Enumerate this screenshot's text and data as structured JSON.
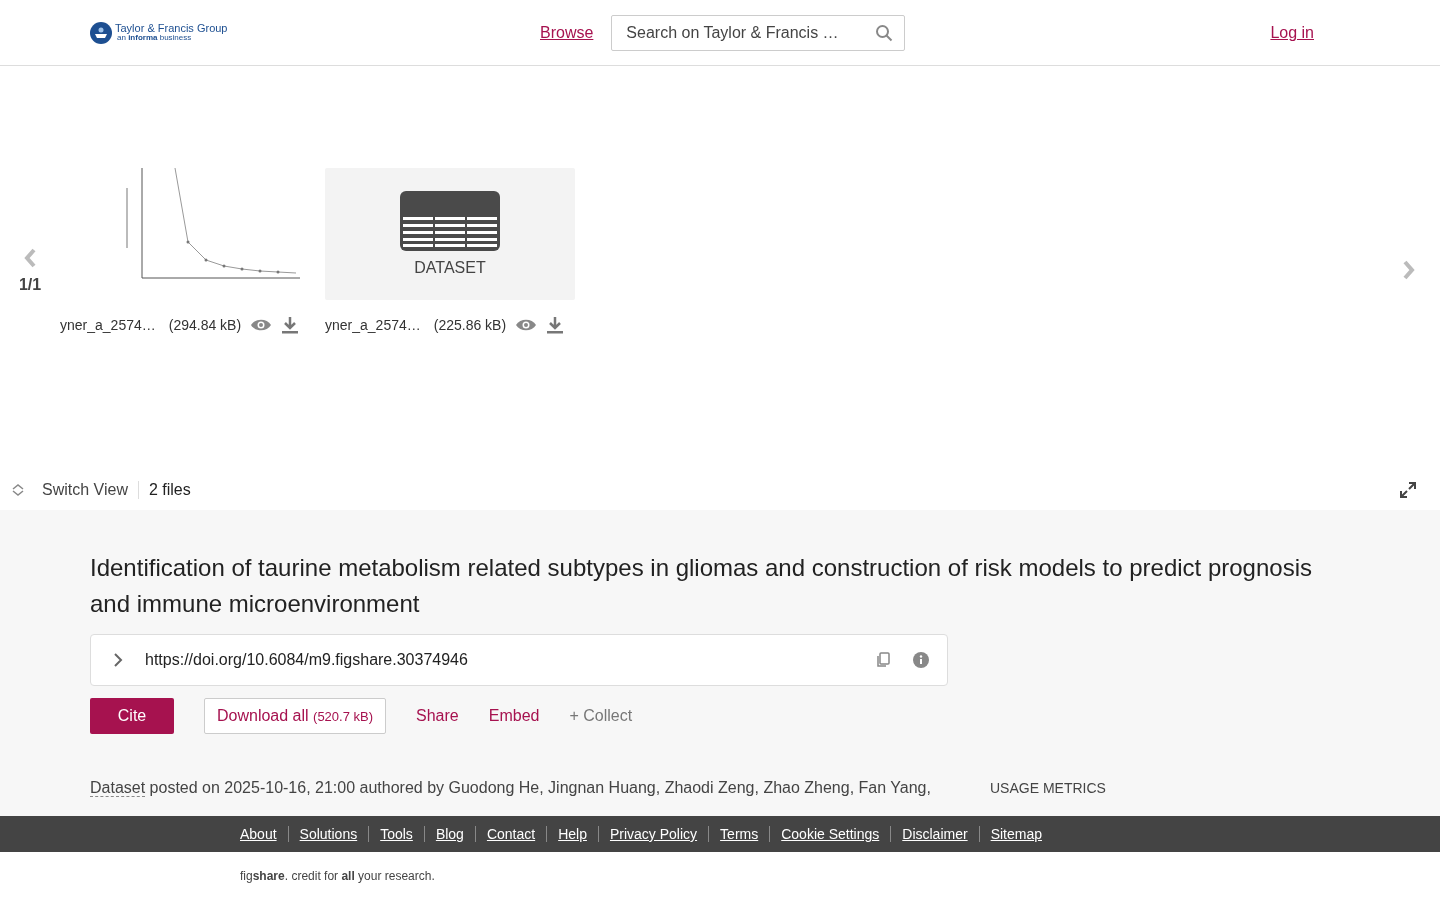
{
  "header": {
    "logo_name": "Taylor & Francis Group",
    "logo_tagline": "an **informa** business",
    "browse": "Browse",
    "search": {
      "placeholder": "Search on Taylor & Francis …"
    },
    "login": "Log in"
  },
  "carousel": {
    "page": "1/1",
    "files": [
      {
        "kind": "chart",
        "name": "yner_a_2574…",
        "size": "(294.84 kB)"
      },
      {
        "kind": "dataset",
        "label": "DATASET",
        "name": "yner_a_2574…",
        "size": "(225.86 kB)"
      }
    ]
  },
  "toolbar": {
    "switch_view": "Switch View",
    "file_count": "2 files"
  },
  "title": "Identification of taurine metabolism related subtypes in gliomas and construction of risk models to predict prognosis and immune microenvironment",
  "doi": "https://doi.org/10.6084/m9.figshare.30374946",
  "actions": {
    "cite": "Cite",
    "download": "Download all",
    "download_size": "(520.7 kB)",
    "share": "Share",
    "embed": "Embed",
    "collect": "+ Collect"
  },
  "byline": {
    "item_type": "Dataset",
    "text": "posted on 2025-10-16, 21:00 authored by Guodong He, Jingnan Huang, Zhaodi Zeng, Zhao Zheng, Fan Yang,"
  },
  "usage_metrics": "USAGE METRICS",
  "footer": {
    "links": [
      "About",
      "Solutions",
      "Tools",
      "Blog",
      "Contact",
      "Help",
      "Privacy Policy",
      "Terms",
      "Cookie Settings",
      "Disclaimer",
      "Sitemap"
    ],
    "credit": "fig**share**. credit for **all** your research."
  }
}
